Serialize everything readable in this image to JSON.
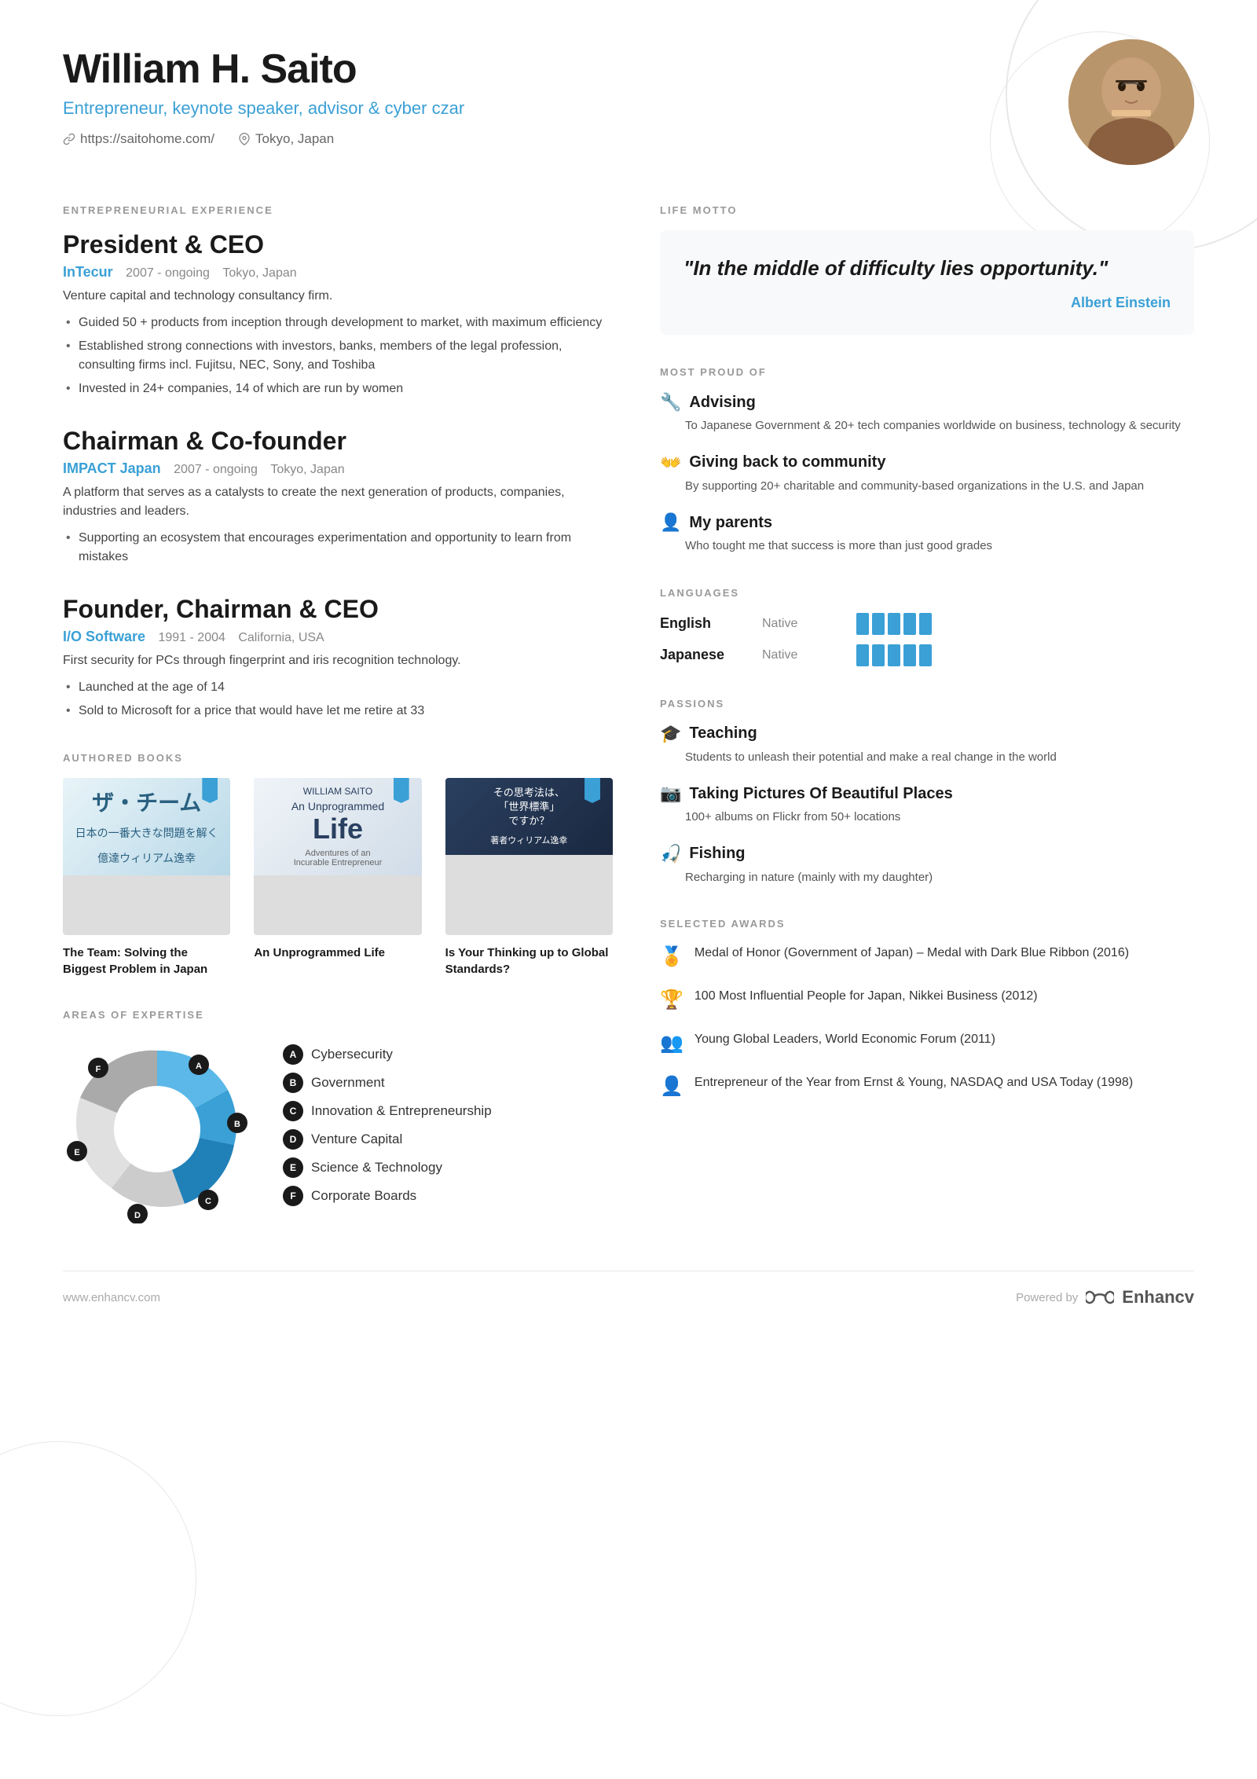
{
  "header": {
    "name": "William H. Saito",
    "subtitle": "Entrepreneur, keynote speaker, advisor & cyber czar",
    "website": "https://saitohome.com/",
    "location": "Tokyo, Japan"
  },
  "life_motto": {
    "label": "LIFE MOTTO",
    "quote": "\"In the middle of difficulty lies opportunity.\"",
    "author": "Albert Einstein"
  },
  "most_proud_of": {
    "label": "MOST PROUD OF",
    "items": [
      {
        "icon": "🔧",
        "title": "Advising",
        "desc": "To Japanese Government & 20+ tech companies worldwide on business, technology & security"
      },
      {
        "icon": "👐",
        "title": "Giving back to community",
        "desc": "By supporting 20+ charitable and community-based organizations in the U.S. and Japan"
      },
      {
        "icon": "👤",
        "title": "My parents",
        "desc": "Who tought me that success is more than just good grades"
      }
    ]
  },
  "languages": {
    "label": "LANGUAGES",
    "items": [
      {
        "name": "English",
        "level": "Native",
        "bars": 5
      },
      {
        "name": "Japanese",
        "level": "Native",
        "bars": 5
      }
    ]
  },
  "passions": {
    "label": "PASSIONS",
    "items": [
      {
        "icon": "🎓",
        "title": "Teaching",
        "desc": "Students to unleash their potential and make a real change in the world"
      },
      {
        "icon": "📷",
        "title": "Taking Pictures Of Beautiful Places",
        "desc": "100+ albums on Flickr from 50+ locations"
      },
      {
        "icon": "🎣",
        "title": "Fishing",
        "desc": "Recharging in nature (mainly with my daughter)"
      }
    ]
  },
  "awards": {
    "label": "SELECTED AWARDS",
    "items": [
      {
        "icon": "🏅",
        "text": "Medal of Honor (Government of Japan) – Medal with Dark Blue Ribbon (2016)"
      },
      {
        "icon": "🏆",
        "text": "100 Most Influential People for Japan, Nikkei Business (2012)"
      },
      {
        "icon": "👥",
        "text": "Young Global Leaders, World Economic Forum (2011)"
      },
      {
        "icon": "👤",
        "text": "Entrepreneur of the Year from Ernst & Young, NASDAQ and USA Today (1998)"
      }
    ]
  },
  "entrepreneurial_experience": {
    "label": "ENTREPRENEURIAL EXPERIENCE",
    "entries": [
      {
        "title": "President & CEO",
        "company": "InTecur",
        "period": "2007 - ongoing",
        "location": "Tokyo, Japan",
        "desc": "Venture capital and technology consultancy firm.",
        "bullets": [
          "Guided 50 + products from inception through development to market, with maximum efficiency",
          "Established strong connections with investors, banks, members of the legal profession, consulting firms incl. Fujitsu, NEC, Sony, and Toshiba",
          "Invested in 24+ companies, 14 of which are run by women"
        ]
      },
      {
        "title": "Chairman & Co-founder",
        "company": "IMPACT Japan",
        "period": "2007 - ongoing",
        "location": "Tokyo, Japan",
        "desc": "A platform that serves as a catalysts to create the next generation of products, companies, industries and leaders.",
        "bullets": [
          "Supporting an ecosystem that encourages experimentation and opportunity to learn from mistakes"
        ]
      },
      {
        "title": "Founder, Chairman & CEO",
        "company": "I/O Software",
        "period": "1991 - 2004",
        "location": "California, USA",
        "desc": "First security for PCs through fingerprint and iris recognition technology.",
        "bullets": [
          "Launched at the age of 14",
          "Sold to Microsoft for a price that would have let me retire at 33"
        ]
      }
    ]
  },
  "books": {
    "label": "AUTHORED BOOKS",
    "items": [
      {
        "cover_text": "ザ・チーム",
        "title": "The Team: Solving the Biggest Problem in Japan"
      },
      {
        "cover_text": "An Unprogrammed Life",
        "title": "An Unprogrammed Life"
      },
      {
        "cover_text": "Is Your Thinking up to Global Standards?",
        "title": "Is Your Thinking up to Global Standards?"
      }
    ]
  },
  "expertise": {
    "label": "AREAS OF EXPERTISE",
    "items": [
      {
        "badge": "A",
        "label": "Cybersecurity"
      },
      {
        "badge": "B",
        "label": "Government"
      },
      {
        "badge": "C",
        "label": "Innovation & Entrepreneurship"
      },
      {
        "badge": "D",
        "label": "Venture Capital"
      },
      {
        "badge": "E",
        "label": "Science & Technology"
      },
      {
        "badge": "F",
        "label": "Corporate Boards"
      }
    ]
  },
  "footer": {
    "website": "www.enhancv.com",
    "powered_by": "Powered by",
    "brand": "Enhancv"
  }
}
